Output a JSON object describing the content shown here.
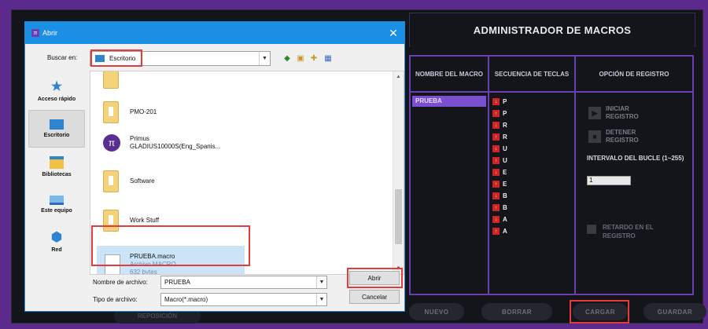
{
  "manager": {
    "title": "ADMINISTRADOR DE MACROS",
    "col_name": "NOMBRE DEL MACRO",
    "col_sequence": "SECUENCIA DE TECLAS",
    "col_option": "OPCIÓN DE REGISTRO",
    "macro_item": "PRUEBA",
    "sequence": [
      {
        "arrow": "↓",
        "key": "P"
      },
      {
        "arrow": "↑",
        "key": "P"
      },
      {
        "arrow": "↓",
        "key": "R"
      },
      {
        "arrow": "↑",
        "key": "R"
      },
      {
        "arrow": "↓",
        "key": "U"
      },
      {
        "arrow": "↑",
        "key": "U"
      },
      {
        "arrow": "↓",
        "key": "E"
      },
      {
        "arrow": "↑",
        "key": "E"
      },
      {
        "arrow": "↓",
        "key": "B"
      },
      {
        "arrow": "↑",
        "key": "B"
      },
      {
        "arrow": "↓",
        "key": "A"
      },
      {
        "arrow": "↑",
        "key": "A"
      }
    ],
    "start_record": "INICIAR REGISTRO",
    "stop_record": "DETENER REGISTRO",
    "loop_label": "INTERVALO DEL BUCLE (1~255)",
    "loop_value": "1",
    "delay_label": "RETARDO EN EL REGISTRO",
    "btn_new": "NUEVO",
    "btn_delete": "BORRAR",
    "btn_load": "CARGAR",
    "btn_save": "GUARDAR",
    "btn_ghost": "REPOSICIÓN",
    "colors": {
      "accent": "#6a3fb0",
      "highlight": "#e53b3b",
      "key_arrow": "#d02424"
    }
  },
  "dialog": {
    "title": "Abrir",
    "look_in_label": "Buscar en:",
    "look_in_value": "Escritorio",
    "places": [
      {
        "label": "Acceso rápido",
        "icon": "star-icon"
      },
      {
        "label": "Escritorio",
        "icon": "desktop-icon"
      },
      {
        "label": "Bibliotecas",
        "icon": "libraries-icon"
      },
      {
        "label": "Este equipo",
        "icon": "computer-icon"
      },
      {
        "label": "Red",
        "icon": "network-icon"
      }
    ],
    "files": {
      "pmo": "PMO-201",
      "primus_1": "Primus",
      "primus_2": "GLADIUS10000S(Eng_Spanis...",
      "software": "Software",
      "work": "Work Stuff",
      "prueba_name": "PRUEBA.macro",
      "prueba_type": "Archivo MACRO",
      "prueba_size": "632 bytes"
    },
    "filename_label": "Nombre de archivo:",
    "filename_value": "PRUEBA",
    "filetype_label": "Tipo de archivo:",
    "filetype_value": "Macro(*.macro)",
    "btn_open": "Abrir",
    "btn_cancel": "Cancelar"
  }
}
